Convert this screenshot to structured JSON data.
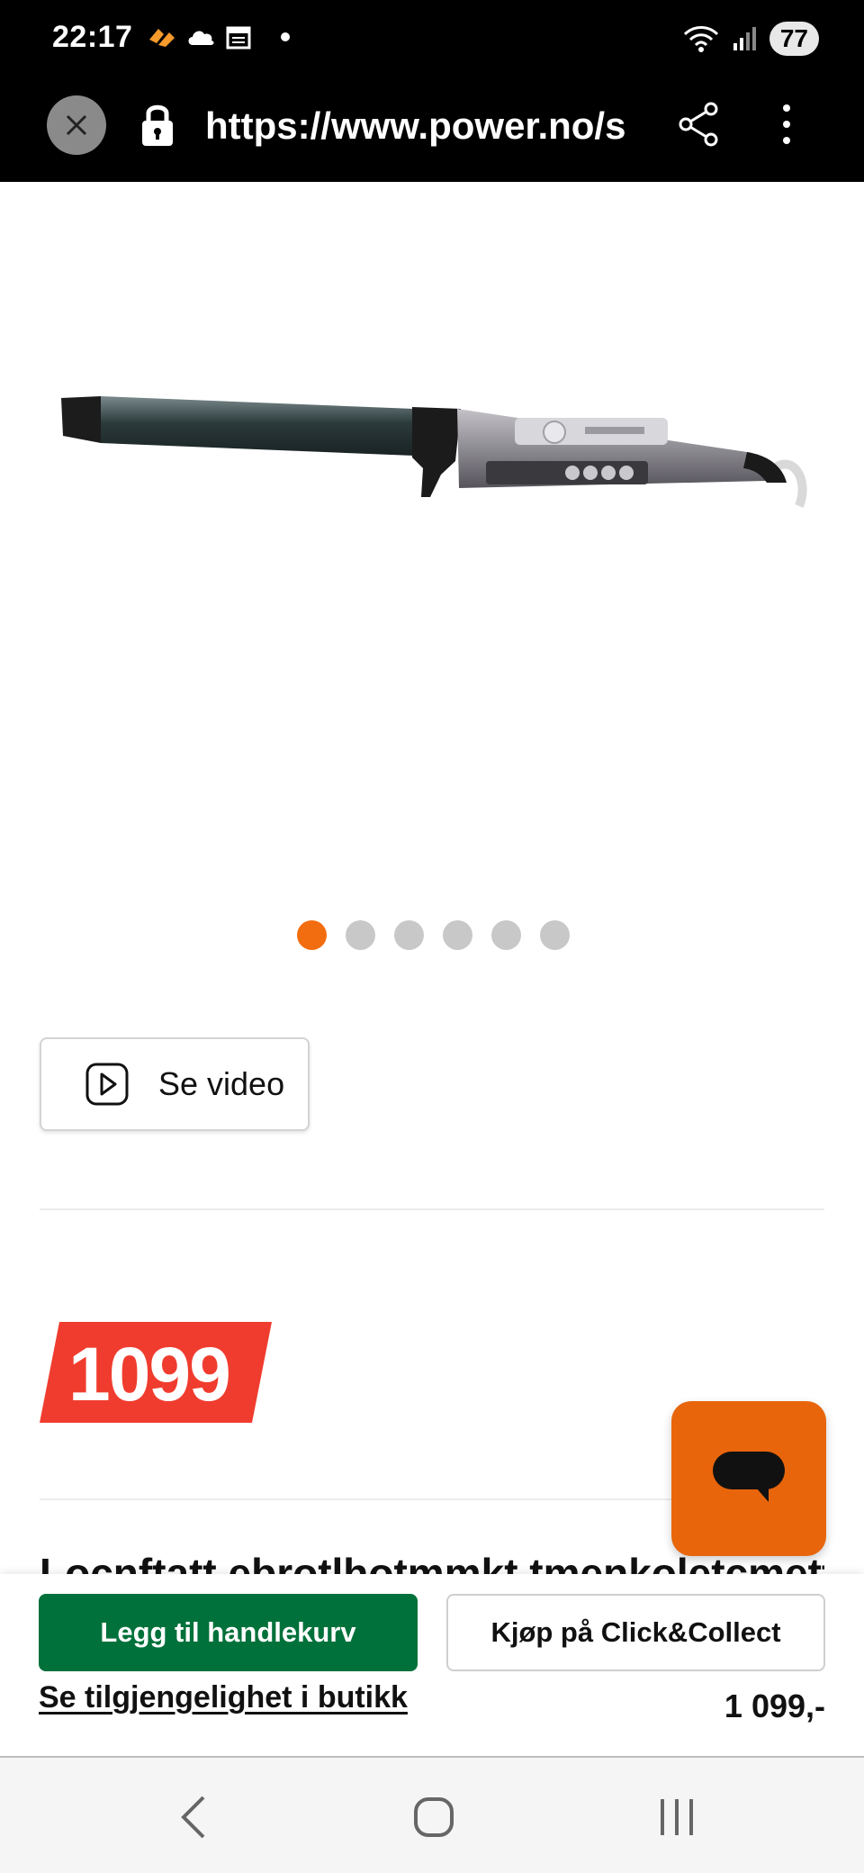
{
  "status_bar": {
    "time": "22:17",
    "battery": "77"
  },
  "browser": {
    "url": "https://www.power.no/s"
  },
  "carousel": {
    "total": 6,
    "active_index": 0
  },
  "video_button": {
    "label": "Se video"
  },
  "price_badge": {
    "value": "1099"
  },
  "product_title_partial": "Locnftatt ebrotlhotmmkt tmenkoletcmett",
  "actions": {
    "add_to_cart": "Legg til handlekurv",
    "click_collect": "Kjøp på Click&Collect",
    "store_availability": "Se tilgjengelighet i butikk",
    "price": "1 099,-"
  },
  "colors": {
    "accent_orange": "#f26d0f",
    "price_red": "#f03c2e",
    "cart_green": "#00713a",
    "chat_orange": "#e8650c"
  }
}
